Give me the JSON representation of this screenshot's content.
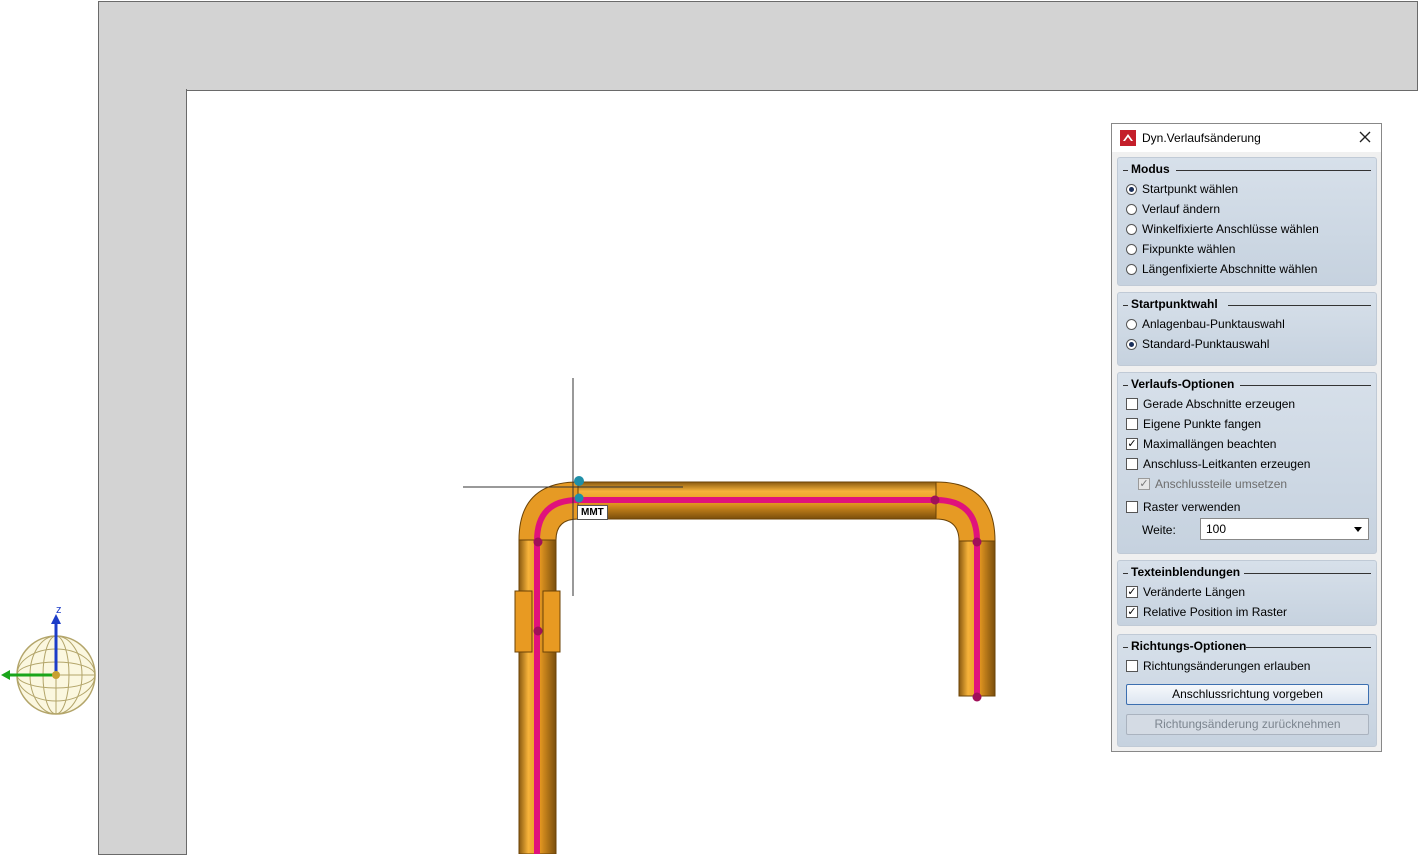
{
  "viewport": {
    "axis_label": "z",
    "point_label": "MMT"
  },
  "panel": {
    "title": "Dyn.Verlaufsänderung",
    "groups": {
      "modus": {
        "title": "Modus",
        "options": [
          {
            "label": "Startpunkt wählen",
            "selected": true
          },
          {
            "label": "Verlauf ändern",
            "selected": false
          },
          {
            "label": "Winkelfixierte Anschlüsse wählen",
            "selected": false
          },
          {
            "label": "Fixpunkte wählen",
            "selected": false
          },
          {
            "label": "Längenfixierte Abschnitte wählen",
            "selected": false
          }
        ]
      },
      "startpunktwahl": {
        "title": "Startpunktwahl",
        "options": [
          {
            "label": "Anlagenbau-Punktauswahl",
            "selected": false
          },
          {
            "label": "Standard-Punktauswahl",
            "selected": true
          }
        ]
      },
      "verlaufs_optionen": {
        "title": "Verlaufs-Optionen",
        "checks": [
          {
            "label": "Gerade Abschnitte erzeugen",
            "checked": false
          },
          {
            "label": "Eigene Punkte fangen",
            "checked": false
          },
          {
            "label": "Maximallängen beachten",
            "checked": true
          },
          {
            "label": "Anschluss-Leitkanten erzeugen",
            "checked": false
          },
          {
            "label": "Anschlussteile umsetzen",
            "checked": true,
            "disabled": true
          },
          {
            "label": "Raster verwenden",
            "checked": false
          }
        ],
        "weite_label": "Weite:",
        "weite_value": "100"
      },
      "texteinblendungen": {
        "title": "Texteinblendungen",
        "checks": [
          {
            "label": "Veränderte Längen",
            "checked": true
          },
          {
            "label": "Relative Position im Raster",
            "checked": true
          }
        ]
      },
      "richtungs_optionen": {
        "title": "Richtungs-Optionen",
        "checks": [
          {
            "label": "Richtungsänderungen erlauben",
            "checked": false
          }
        ],
        "button_primary": "Anschlussrichtung vorgeben",
        "button_disabled": "Richtungsänderung zurücknehmen"
      }
    }
  },
  "colors": {
    "pipe": "#e8a12e",
    "pipe_dark": "#9a6410",
    "centerline": "#e0127c",
    "node": "#a0105a",
    "start_node": "#1f8fa8",
    "wall": "#d3d3d3"
  }
}
